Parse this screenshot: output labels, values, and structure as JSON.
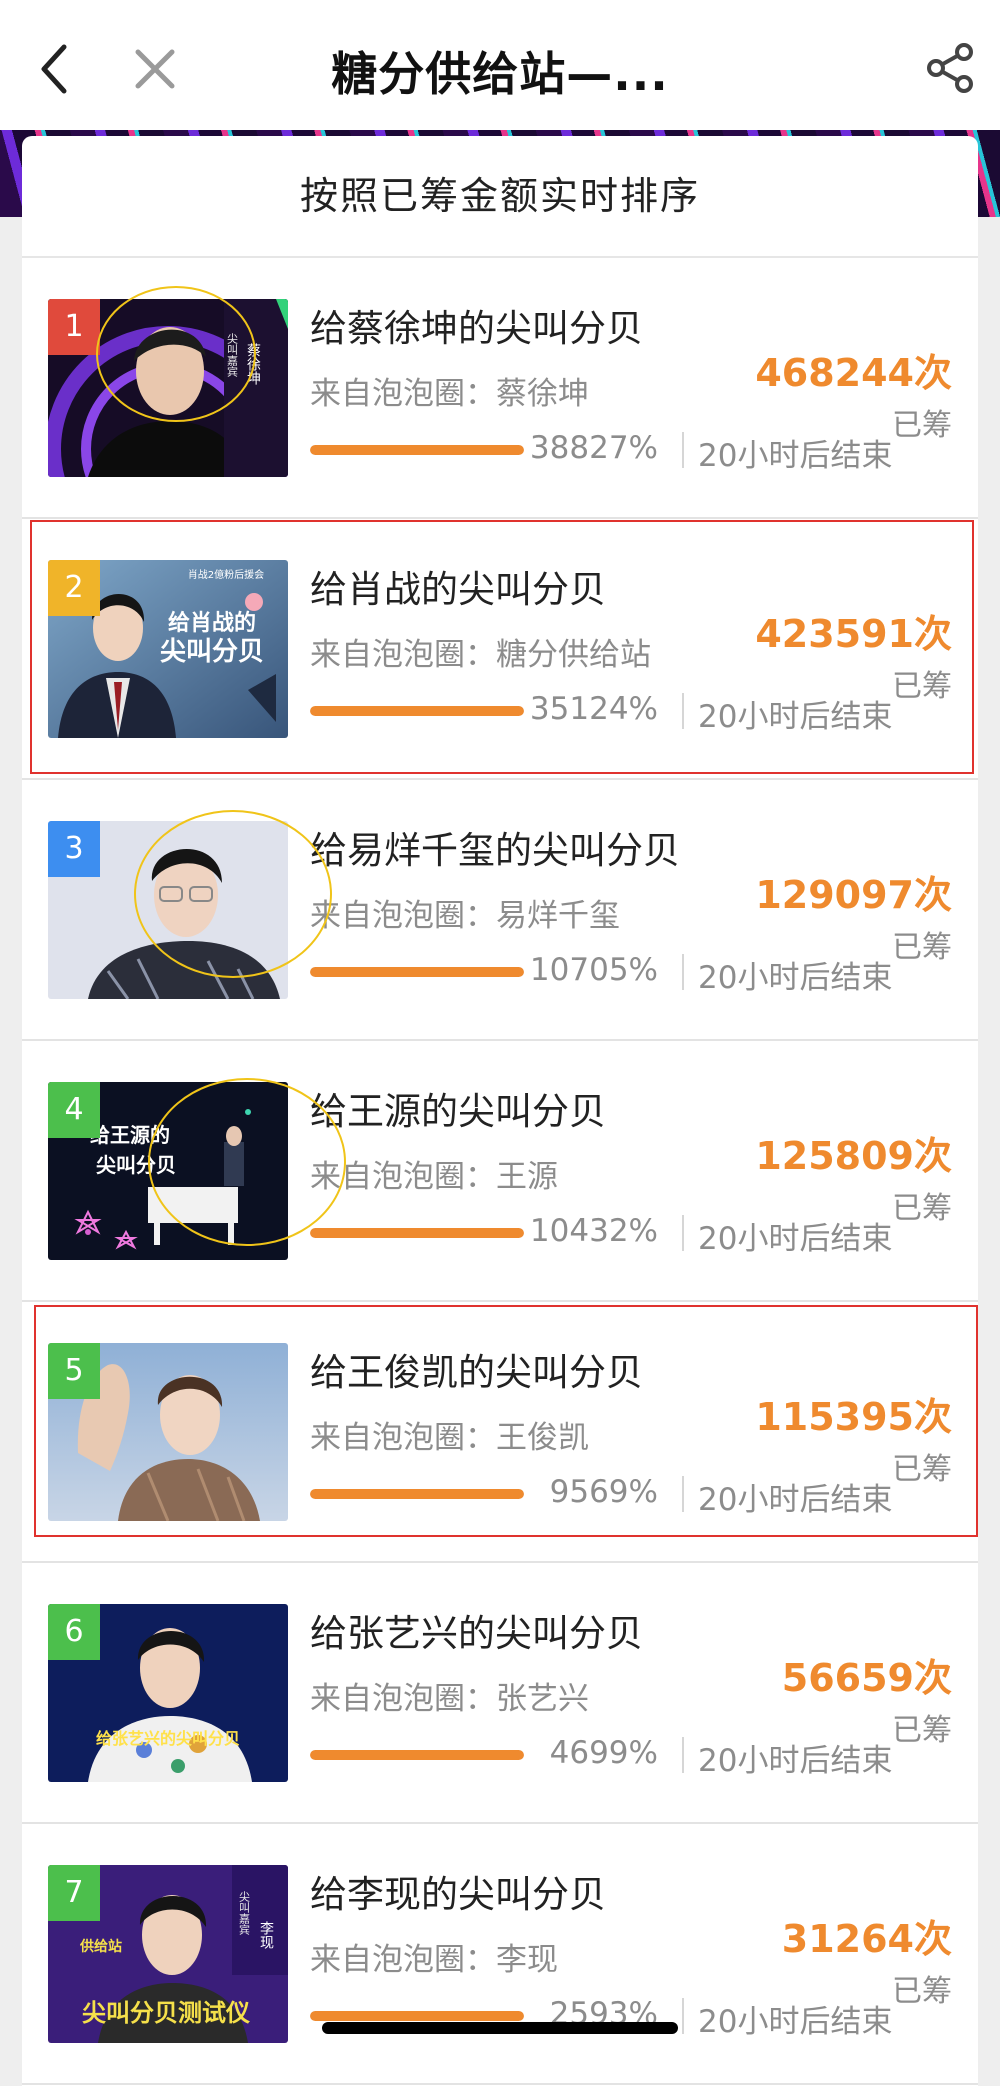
{
  "nav": {
    "title": "糖分供给站—...",
    "back_icon": "chevron-left-icon",
    "close_icon": "close-icon",
    "share_icon": "share-icon"
  },
  "list": {
    "header": "按照已筹金额实时排序",
    "raised_label": "已筹",
    "items": [
      {
        "rank": "1",
        "title": "给蔡徐坤的尖叫分贝",
        "source": "来自泡泡圈：蔡徐坤",
        "percent": "38827%",
        "ends": "20小时后结束",
        "count": "468244次",
        "progress": 1.0,
        "badge_color": "#e04a3c"
      },
      {
        "rank": "2",
        "title": "给肖战的尖叫分贝",
        "source": "来自泡泡圈：糖分供给站",
        "percent": "35124%",
        "ends": "20小时后结束",
        "count": "423591次",
        "progress": 1.0,
        "badge_color": "#f0b429"
      },
      {
        "rank": "3",
        "title": "给易烊千玺的尖叫分贝",
        "source": "来自泡泡圈：易烊千玺",
        "percent": "10705%",
        "ends": "20小时后结束",
        "count": "129097次",
        "progress": 1.0,
        "badge_color": "#3d8ef0"
      },
      {
        "rank": "4",
        "title": "给王源的尖叫分贝",
        "source": "来自泡泡圈：王源",
        "percent": "10432%",
        "ends": "20小时后结束",
        "count": "125809次",
        "progress": 1.0,
        "badge_color": "#4cbf4c"
      },
      {
        "rank": "5",
        "title": "给王俊凯的尖叫分贝",
        "source": "来自泡泡圈：王俊凯",
        "percent": "9569%",
        "ends": "20小时后结束",
        "count": "115395次",
        "progress": 1.0,
        "badge_color": "#4cbf4c"
      },
      {
        "rank": "6",
        "title": "给张艺兴的尖叫分贝",
        "source": "来自泡泡圈：张艺兴",
        "percent": "4699%",
        "ends": "20小时后结束",
        "count": "56659次",
        "progress": 1.0,
        "badge_color": "#4cbf4c"
      },
      {
        "rank": "7",
        "title": "给李现的尖叫分贝",
        "source": "来自泡泡圈：李现",
        "percent": "2593%",
        "ends": "20小时后结束",
        "count": "31264次",
        "progress": 1.0,
        "badge_color": "#4cbf4c"
      }
    ]
  },
  "thumbs": {
    "t1": {
      "tag": "尖叫嘉宾",
      "name": "蔡徐坤"
    },
    "t2": {
      "org": "肖战2億粉后援会",
      "caption1": "给肖战的",
      "caption2": "尖叫分贝"
    },
    "t4": {
      "caption1": "给王源的",
      "caption2": "尖叫分贝"
    },
    "t6": {
      "caption": "给张艺兴的尖叫分贝"
    },
    "t7": {
      "tag": "尖叫嘉宾",
      "name": "李现",
      "caption": "尖叫分贝测试仪",
      "station": "供给站"
    }
  }
}
